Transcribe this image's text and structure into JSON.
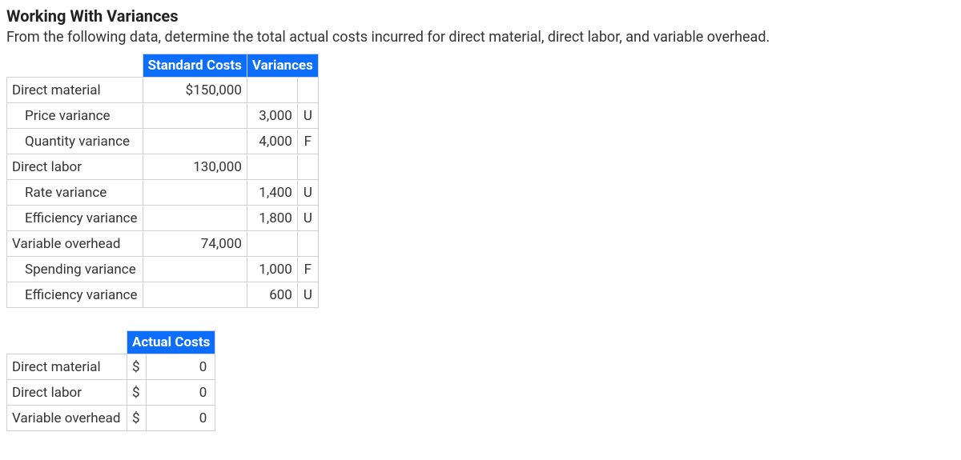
{
  "heading": "Working With Variances",
  "instructions": "From the following data, determine the total actual costs incurred for direct material, direct labor, and variable overhead.",
  "table1": {
    "headers": {
      "stdcosts": "Standard Costs",
      "variances": "Variances"
    },
    "rows": [
      {
        "label": "Direct material",
        "std": "$150,000",
        "var": "",
        "flag": "",
        "indent": false
      },
      {
        "label": "Price variance",
        "std": "",
        "var": "3,000",
        "flag": "U",
        "indent": true
      },
      {
        "label": "Quantity variance",
        "std": "",
        "var": "4,000",
        "flag": "F",
        "indent": true
      },
      {
        "label": "Direct labor",
        "std": "130,000",
        "var": "",
        "flag": "",
        "indent": false
      },
      {
        "label": "Rate variance",
        "std": "",
        "var": "1,400",
        "flag": "U",
        "indent": true
      },
      {
        "label": "Efficiency variance",
        "std": "",
        "var": "1,800",
        "flag": "U",
        "indent": true
      },
      {
        "label": "Variable overhead",
        "std": "74,000",
        "var": "",
        "flag": "",
        "indent": false
      },
      {
        "label": "Spending variance",
        "std": "",
        "var": "1,000",
        "flag": "F",
        "indent": true
      },
      {
        "label": "Efficiency variance",
        "std": "",
        "var": "600",
        "flag": "U",
        "indent": true
      }
    ]
  },
  "table2": {
    "header": "Actual Costs",
    "rows": [
      {
        "label": "Direct material",
        "currency": "$",
        "value": "0"
      },
      {
        "label": "Direct labor",
        "currency": "$",
        "value": "0"
      },
      {
        "label": "Variable overhead",
        "currency": "$",
        "value": "0"
      }
    ]
  }
}
